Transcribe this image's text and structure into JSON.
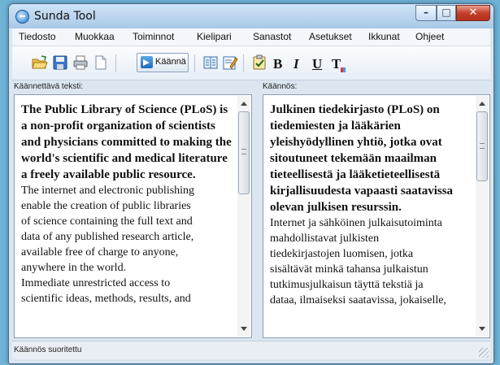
{
  "window": {
    "title": "Sunda Tool"
  },
  "menu": {
    "items": [
      "Tiedosto",
      "Muokkaa",
      "Toiminnot",
      "Kielipari",
      "Sanastot",
      "Asetukset",
      "Ikkunat",
      "Ohjeet"
    ]
  },
  "toolbar": {
    "translate_label": "Käännä",
    "bold_label": "B",
    "italic_label": "I",
    "underline_label": "U",
    "font_color_label": "T",
    "icons": [
      "open-folder-icon",
      "save-icon",
      "print-icon",
      "new-document-icon",
      "translate-icon",
      "dictionary-icon",
      "edit-icon",
      "checklist-icon",
      "bold-icon",
      "italic-icon",
      "underline-icon",
      "font-color-icon"
    ]
  },
  "source": {
    "label": "Käännettävä teksti:",
    "bold_text": "The Public Library of Science (PLoS) is a non-profit organization of scientists and physicians committed to making the world's scientific and medical literature a freely available public resource.",
    "lines": [
      "The internet and electronic publishing",
      "enable the creation of public libraries",
      "of science containing the full text and",
      "data of any published research article,",
      "available free of charge to anyone,",
      "anywhere in the world.",
      "Immediate unrestricted access to",
      "scientific ideas, methods, results, and"
    ]
  },
  "target": {
    "label": "Käännös:",
    "bold_text": "Julkinen tiedekirjasto (PLoS) on tiedemiesten ja lääkärien yleishyödyllinen yhtiö, jotka ovat sitoutuneet tekemään maailman tieteellisestä ja lääketieteellisestä kirjallisuudesta vapaasti saatavissa olevan julkisen resurssin.",
    "lines": [
      "Internet ja sähköinen julkaisutoiminta",
      "mahdollistavat julkisten",
      "tiedekirjastojen luomisen, jotka",
      "sisältävät minkä tahansa julkaistun",
      "tutkimusjulkaisun täyttä tekstiä ja",
      "dataa, ilmaiseksi saatavissa, jokaiselle,"
    ]
  },
  "status": {
    "text": "Käännös suoritettu"
  },
  "colors": {
    "desktop": "#6fb3d6",
    "titlebar": "#a9c8e6",
    "close": "#c4402a"
  }
}
